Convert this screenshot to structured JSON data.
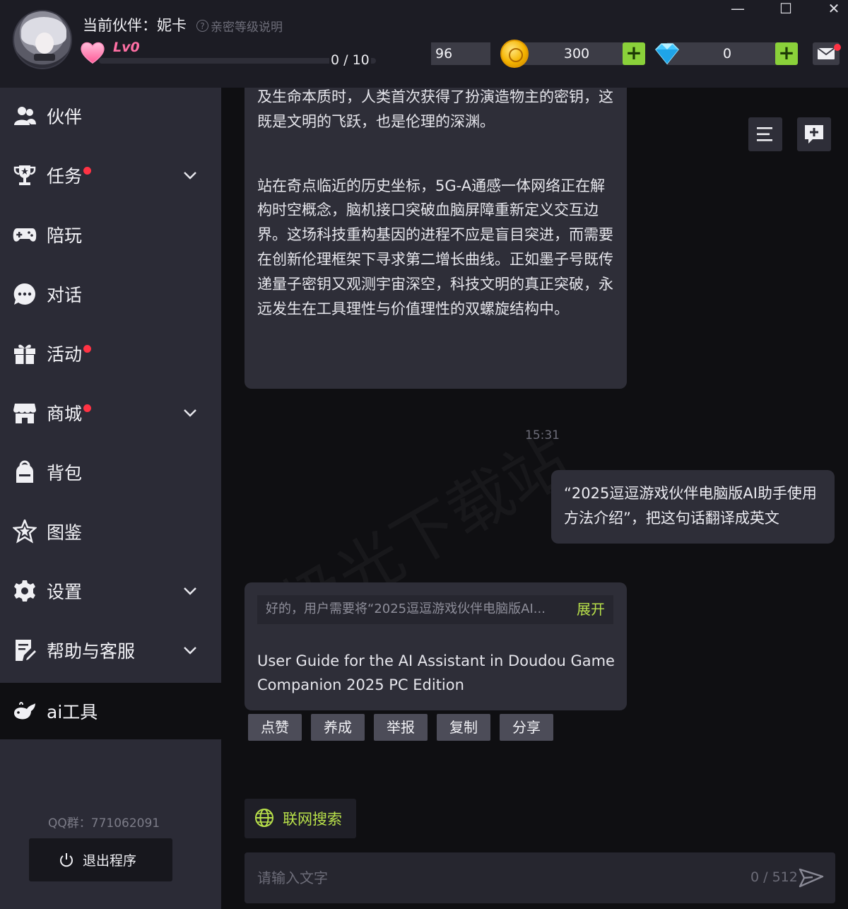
{
  "window": {
    "minimize_symbol": "—",
    "maximize_symbol": "☐",
    "close_symbol": "✕"
  },
  "header": {
    "partner_label": "当前伙伴：妮卡",
    "intimacy_help": "亲密等级说明",
    "level": "Lv0",
    "level_progress_text": "0 / 10",
    "level_progress_fraction": 0,
    "energy": "96",
    "coins": "300",
    "gems": "0",
    "has_unread_mail": true,
    "icons": {
      "heart": "heart-icon",
      "coin": "coin-icon",
      "gem": "diamond-icon",
      "mail": "mail-icon"
    },
    "colors": {
      "heart": "#ff6fa4",
      "plus": "#8ad13a",
      "badge": "#ff3344"
    }
  },
  "sidebar": {
    "items": [
      {
        "label": "伙伴",
        "icon": "partner-icon",
        "badge": false,
        "expandable": false
      },
      {
        "label": "任务",
        "icon": "trophy-icon",
        "badge": true,
        "expandable": true
      },
      {
        "label": "陪玩",
        "icon": "gamepad-icon",
        "badge": false,
        "expandable": false
      },
      {
        "label": "对话",
        "icon": "chat-icon",
        "badge": false,
        "expandable": false
      },
      {
        "label": "活动",
        "icon": "gift-icon",
        "badge": true,
        "expandable": false
      },
      {
        "label": "商城",
        "icon": "store-icon",
        "badge": true,
        "expandable": true
      },
      {
        "label": "背包",
        "icon": "backpack-icon",
        "badge": false,
        "expandable": false
      },
      {
        "label": "图鉴",
        "icon": "star-badge-icon",
        "badge": false,
        "expandable": false
      },
      {
        "label": "设置",
        "icon": "gear-icon",
        "badge": false,
        "expandable": true
      },
      {
        "label": "帮助与客服",
        "icon": "help-edit-icon",
        "badge": false,
        "expandable": true
      },
      {
        "label": "ai工具",
        "icon": "whale-icon",
        "badge": false,
        "expandable": false,
        "active": true
      }
    ],
    "qq_group": "QQ群：771062091",
    "exit_label": "退出程序"
  },
  "chat": {
    "messages": [
      {
        "role": "assistant",
        "paragraphs": [
          "及生命本质时，人类首次获得了扮演造物主的密钥，这既是文明的飞跃，也是伦理的深渊。",
          " 站在奇点临近的历史坐标，5G-A通感一体网络正在解构时空概念，脑机接口突破血脑屏障重新定义交互边界。这场科技重构基因的进程不应是盲目突进，而需要在创新伦理框架下寻求第二增长曲线。正如墨子号既传递量子密钥又观测宇宙深空，科技文明的真正突破，永远发生在工具理性与价值理性的双螺旋结构中。"
        ]
      },
      {
        "role": "timestamp",
        "text": "15:31"
      },
      {
        "role": "user",
        "text": "“2025逗逗游戏伙伴电脑版AI助手使用方法介绍”，把这句话翻译成英文"
      },
      {
        "role": "assistant",
        "thinking_preview": "好的，用户需要将“2025逗逗游戏伙伴电脑版AI...",
        "expand_label": "展开",
        "text": "User Guide for the AI Assistant in Doudou Game Companion 2025 PC Edition"
      }
    ],
    "actions": [
      "点赞",
      "养成",
      "举报",
      "复制",
      "分享"
    ],
    "web_search_label": "联网搜索",
    "input_placeholder": "请输入文字",
    "input_value": "",
    "char_counter": "0 / 512",
    "watermark": "极光下载站"
  }
}
